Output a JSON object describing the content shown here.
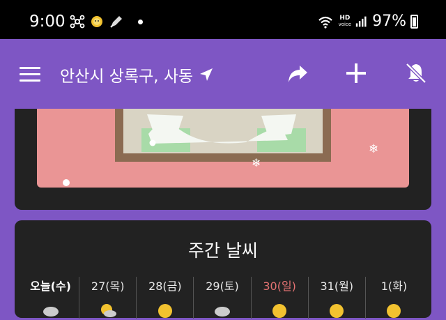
{
  "status_bar": {
    "time": "9:00",
    "hd_line1": "HD",
    "hd_line2": "voice",
    "battery": "97%"
  },
  "app_bar": {
    "location": "안산시 상록구, 사동",
    "icons": [
      "menu-icon",
      "location-arrow-icon",
      "share-icon",
      "add-icon",
      "notifications-off-icon"
    ]
  },
  "weekly": {
    "title": "주간 날씨",
    "days": [
      {
        "label": "오늘(수)",
        "icon": "cloudy-icon"
      },
      {
        "label": "27(목)",
        "icon": "partly-sunny-icon"
      },
      {
        "label": "28(금)",
        "icon": "sunny-icon"
      },
      {
        "label": "29(토)",
        "icon": "cloudy-icon"
      },
      {
        "label": "30(일)",
        "icon": "sunny-icon"
      },
      {
        "label": "31(월)",
        "icon": "sunny-icon"
      },
      {
        "label": "1(화)",
        "icon": "sunny-icon"
      }
    ]
  },
  "colors": {
    "appbar": "#7e56c4",
    "card": "#222222",
    "illustration": "#ea9595",
    "sunday": "#e57373"
  }
}
